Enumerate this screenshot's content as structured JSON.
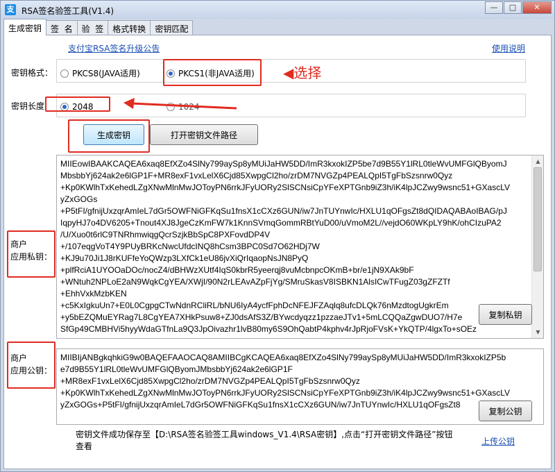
{
  "window": {
    "title": "RSA签名验签工具(V1.4)",
    "controls": [
      "—",
      "□",
      "✕"
    ]
  },
  "tabs": [
    "生成密钥",
    "签  名",
    "验  签",
    "格式转换",
    "密钥匹配"
  ],
  "links": {
    "upgrade_notice": "支付宝RSA签名升级公告",
    "manual": "使用说明",
    "upload_public_key": "上传公钥"
  },
  "key_format": {
    "label": "密钥格式：",
    "options": [
      "PKCS8(JAVA适用)",
      "PKCS1(非JAVA适用)"
    ],
    "selected": "PKCS1(非JAVA适用)"
  },
  "key_length": {
    "label": "密钥长度",
    "options": [
      "2048",
      "1024"
    ],
    "selected": "2048"
  },
  "buttons": {
    "generate": "生成密钥",
    "open_path": "打开密钥文件路径",
    "copy_private": "复制私钥",
    "copy_public": "复制公钥"
  },
  "annotation": {
    "select_label": "选择"
  },
  "private_key": {
    "label_line1": "商户",
    "label_line2": "应用私钥：",
    "lines": [
      "MIIEowIBAAKCAQEA6xaq8EfXZo4SlNy799aySp8yMUiJaHW5DD/ImR3kxokIZP5be7d9B55Y1lRL0tleWvUMFGlQByomJ",
      "MbsbbYj624ak2e6lGP1F+MR8exF1vxLelX6Cjd85XwpgCl2ho/zrDM7NVGZp4PEALQpI5TgFbSzsnrw0Qyz",
      "+Kp0KWlhTxKehedLZgXNwMlnMwJOToyPN6rrkJFyUORy2SlSCNsiCpYFeXPTGnb9iZ3h/iK4lpJCZwy9wsnc51+GXascLV",
      "yZxGOGs",
      "+P5tFI/gfnijUxzqrAmIeL7dGr5OWFNiGFKqSu1fnsX1cCXz6GUN/iw7JnTUYnwIc/HXLU1qOFgsZt8dQIDAQABAoIBAG/pJ",
      "IqpyHJ7o4DV6205+Tnout4XJ8JgeCzKmFW7k1KnnSVmqGommRBtYuD00/uVmoM2L//vejdO60WKpLY9hK/ohCIzuPA2",
      "/U/Xuo0t6rlC9TNRhmwiqgQcrSzjkBbSpC8PXFovdDP4V",
      "+/107eqgVoT4Y9PUyBRKcNwcUfdcINQ8hCsm3BPC0Sd7O62HDj7W",
      "+KJ9u70Ji1J8rKUFfeYoQWzp3LXfCk1eU86jvXiQrIqaopNsJN8PyQ",
      "+plfRciA1UYOOaDOc/nocZ4/dBHWzXUtf4IqS0kbrR5yeerqj8vuMcbnpcOKmB+br/e1jN9XAk9bF",
      "+WNtuh2NPLoE2aN9WqkCgYEA/XWjI/90N2rLEAvAZpFjYg/SMruSkasV8ISBKN1AlsICwTFugZ03gZFZTf",
      "+EhhVxkMzbKEN",
      "+c5KxIgkuUn7+E0L0CgpgCTwNdnRCliRL/bNU6IyA4ycfFphDcNFEJFZAqlq8ufcDLQk76nMzdtogUgkrEm",
      "+y5bEZQMuEYRag7L8CgYEA7XHkPsuw8+ZJ0dsAfS3Z/BYwcdyqzz1pzzaeJTv1+5mLCQQaZgwDUO7/H7e",
      "SfGp49CMBHVi5hyyWdaGTfnLa9Q3JpOivazhr1lvB80my6S9OhQabtP4kphv4rJpRjoFVsK+YkQTP/4lgxTo+sOEz"
    ]
  },
  "public_key": {
    "label_line1": "商户",
    "label_line2": "应用公钥：",
    "lines": [
      "MIIBIjANBgkqhkiG9w0BAQEFAAOCAQ8AMIIBCgKCAQEA6xaq8EfXZo4SlNy799aySp8yMUiJaHW5DD/ImR3kxokIZP5b",
      "e7d9B55Y1lRL0tleWvUMFGlQByomJMbsbbYj624ak2e6lGP1F",
      "+MR8exF1vxLelX6Cjd85XwpgCl2ho/zrDM7NVGZp4PEALQpI5TgFbSzsnrw0Qyz",
      "+Kp0KWlhTxKehedLZgXNwMlnMwJOToyPN6rrkJFyUORy2SlSCNsiCpYFeXPTGnb9iZ3h/iK4lpJCZwy9wsnc51+GXascLV",
      "yZxGOGs+P5tFI/gfnijUxzqrAmIeL7dGr5OWFNiGFKqSu1fnsX1cCXz6GUN/iw7JnTUYnwIc/HXLU1qOFgsZt8"
    ]
  },
  "status": {
    "line1": "密钥文件成功保存至【D:\\RSA签名验签工具windows_V1.4\\RSA密钥】,点击“打开密钥文件路径”按钮",
    "line2": "查看"
  },
  "colors": {
    "accent": "#1a4fb3",
    "annotation": "#e02b20"
  }
}
